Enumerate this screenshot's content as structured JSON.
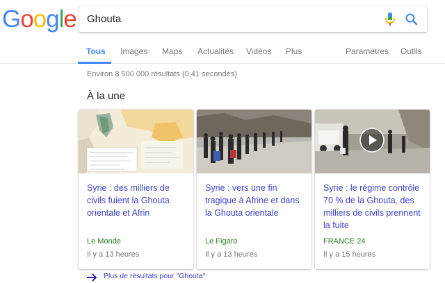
{
  "logo": {
    "letters": [
      {
        "char": "G",
        "color": "#4285F4"
      },
      {
        "char": "o",
        "color": "#EA4335"
      },
      {
        "char": "o",
        "color": "#FBBC05"
      },
      {
        "char": "g",
        "color": "#4285F4"
      },
      {
        "char": "l",
        "color": "#34A853"
      },
      {
        "char": "e",
        "color": "#EA4335"
      }
    ]
  },
  "search": {
    "value": "Ghouta",
    "mic_icon": "microphone-icon",
    "search_icon": "magnifier-icon"
  },
  "tabs": {
    "all": "Tous",
    "images": "Images",
    "maps": "Maps",
    "news": "Actualités",
    "videos": "Vidéos",
    "more": "Plus",
    "settings": "Paramètres",
    "tools": "Outils"
  },
  "results": {
    "stats": "Environ 8 500 000 résultats (0,41 secondes)"
  },
  "top_stories": {
    "title": "À la une",
    "cards": [
      {
        "title": "Syrie : des milliers de civils fuient la Ghouta orientale et Afrin",
        "source": "Le Monde",
        "time": "Il y a 13 heures",
        "image": "map-thumbnail"
      },
      {
        "title": "Syrie : vers une fin tragique à Afrine et dans la Ghouta orientale",
        "source": "Le Figaro",
        "time": "Il y a 13 heures",
        "image": "refugees-photo-thumbnail"
      },
      {
        "title": "Syrie : le régime contrôle 70 % de la Ghouta, des milliers de civils prennent la fuite",
        "source": "FRANCE 24",
        "time": "Il y a 15 heures",
        "image": "video-thumbnail"
      }
    ],
    "more_link": "Plus de résultats pour \"Ghouta\""
  },
  "colors": {
    "link": "#3c42c7",
    "source": "#2a7a2a",
    "tab_active": "#4285f4",
    "muted": "#777777"
  }
}
